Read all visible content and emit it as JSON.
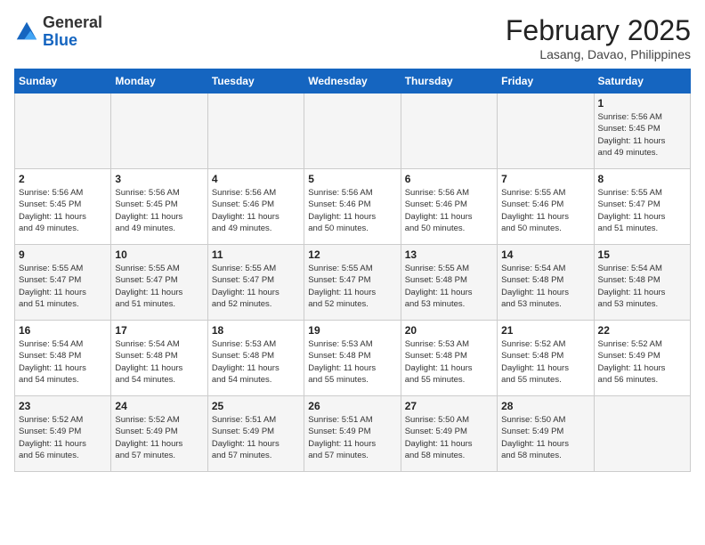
{
  "header": {
    "logo_line1": "General",
    "logo_line2": "Blue",
    "month": "February 2025",
    "location": "Lasang, Davao, Philippines"
  },
  "weekdays": [
    "Sunday",
    "Monday",
    "Tuesday",
    "Wednesday",
    "Thursday",
    "Friday",
    "Saturday"
  ],
  "weeks": [
    [
      {
        "day": "",
        "info": ""
      },
      {
        "day": "",
        "info": ""
      },
      {
        "day": "",
        "info": ""
      },
      {
        "day": "",
        "info": ""
      },
      {
        "day": "",
        "info": ""
      },
      {
        "day": "",
        "info": ""
      },
      {
        "day": "1",
        "info": "Sunrise: 5:56 AM\nSunset: 5:45 PM\nDaylight: 11 hours\nand 49 minutes."
      }
    ],
    [
      {
        "day": "2",
        "info": "Sunrise: 5:56 AM\nSunset: 5:45 PM\nDaylight: 11 hours\nand 49 minutes."
      },
      {
        "day": "3",
        "info": "Sunrise: 5:56 AM\nSunset: 5:45 PM\nDaylight: 11 hours\nand 49 minutes."
      },
      {
        "day": "4",
        "info": "Sunrise: 5:56 AM\nSunset: 5:46 PM\nDaylight: 11 hours\nand 49 minutes."
      },
      {
        "day": "5",
        "info": "Sunrise: 5:56 AM\nSunset: 5:46 PM\nDaylight: 11 hours\nand 50 minutes."
      },
      {
        "day": "6",
        "info": "Sunrise: 5:56 AM\nSunset: 5:46 PM\nDaylight: 11 hours\nand 50 minutes."
      },
      {
        "day": "7",
        "info": "Sunrise: 5:55 AM\nSunset: 5:46 PM\nDaylight: 11 hours\nand 50 minutes."
      },
      {
        "day": "8",
        "info": "Sunrise: 5:55 AM\nSunset: 5:47 PM\nDaylight: 11 hours\nand 51 minutes."
      }
    ],
    [
      {
        "day": "9",
        "info": "Sunrise: 5:55 AM\nSunset: 5:47 PM\nDaylight: 11 hours\nand 51 minutes."
      },
      {
        "day": "10",
        "info": "Sunrise: 5:55 AM\nSunset: 5:47 PM\nDaylight: 11 hours\nand 51 minutes."
      },
      {
        "day": "11",
        "info": "Sunrise: 5:55 AM\nSunset: 5:47 PM\nDaylight: 11 hours\nand 52 minutes."
      },
      {
        "day": "12",
        "info": "Sunrise: 5:55 AM\nSunset: 5:47 PM\nDaylight: 11 hours\nand 52 minutes."
      },
      {
        "day": "13",
        "info": "Sunrise: 5:55 AM\nSunset: 5:48 PM\nDaylight: 11 hours\nand 53 minutes."
      },
      {
        "day": "14",
        "info": "Sunrise: 5:54 AM\nSunset: 5:48 PM\nDaylight: 11 hours\nand 53 minutes."
      },
      {
        "day": "15",
        "info": "Sunrise: 5:54 AM\nSunset: 5:48 PM\nDaylight: 11 hours\nand 53 minutes."
      }
    ],
    [
      {
        "day": "16",
        "info": "Sunrise: 5:54 AM\nSunset: 5:48 PM\nDaylight: 11 hours\nand 54 minutes."
      },
      {
        "day": "17",
        "info": "Sunrise: 5:54 AM\nSunset: 5:48 PM\nDaylight: 11 hours\nand 54 minutes."
      },
      {
        "day": "18",
        "info": "Sunrise: 5:53 AM\nSunset: 5:48 PM\nDaylight: 11 hours\nand 54 minutes."
      },
      {
        "day": "19",
        "info": "Sunrise: 5:53 AM\nSunset: 5:48 PM\nDaylight: 11 hours\nand 55 minutes."
      },
      {
        "day": "20",
        "info": "Sunrise: 5:53 AM\nSunset: 5:48 PM\nDaylight: 11 hours\nand 55 minutes."
      },
      {
        "day": "21",
        "info": "Sunrise: 5:52 AM\nSunset: 5:48 PM\nDaylight: 11 hours\nand 55 minutes."
      },
      {
        "day": "22",
        "info": "Sunrise: 5:52 AM\nSunset: 5:49 PM\nDaylight: 11 hours\nand 56 minutes."
      }
    ],
    [
      {
        "day": "23",
        "info": "Sunrise: 5:52 AM\nSunset: 5:49 PM\nDaylight: 11 hours\nand 56 minutes."
      },
      {
        "day": "24",
        "info": "Sunrise: 5:52 AM\nSunset: 5:49 PM\nDaylight: 11 hours\nand 57 minutes."
      },
      {
        "day": "25",
        "info": "Sunrise: 5:51 AM\nSunset: 5:49 PM\nDaylight: 11 hours\nand 57 minutes."
      },
      {
        "day": "26",
        "info": "Sunrise: 5:51 AM\nSunset: 5:49 PM\nDaylight: 11 hours\nand 57 minutes."
      },
      {
        "day": "27",
        "info": "Sunrise: 5:50 AM\nSunset: 5:49 PM\nDaylight: 11 hours\nand 58 minutes."
      },
      {
        "day": "28",
        "info": "Sunrise: 5:50 AM\nSunset: 5:49 PM\nDaylight: 11 hours\nand 58 minutes."
      },
      {
        "day": "",
        "info": ""
      }
    ]
  ]
}
